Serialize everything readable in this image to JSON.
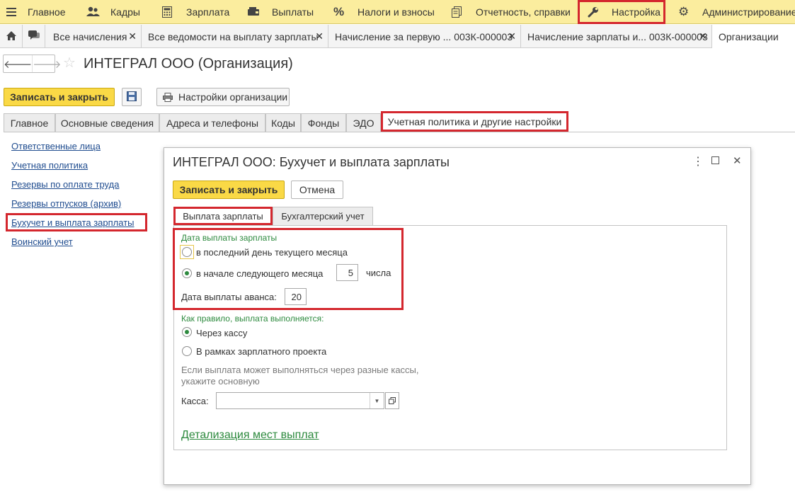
{
  "top_menu": {
    "items": [
      {
        "label": "Главное",
        "icon": "hamburger-icon"
      },
      {
        "label": "Кадры",
        "icon": "people-icon"
      },
      {
        "label": "Зарплата",
        "icon": "calculator-icon"
      },
      {
        "label": "Выплаты",
        "icon": "wallet-icon"
      },
      {
        "label": "Налоги и взносы",
        "icon": "percent-icon"
      },
      {
        "label": "Отчетность, справки",
        "icon": "documents-icon"
      },
      {
        "label": "Настройка",
        "icon": "wrench-icon"
      },
      {
        "label": "Администрирование",
        "icon": "gear-icon"
      }
    ]
  },
  "window_tabs": [
    "Все начисления",
    "Все ведомости на выплату зарплаты",
    "Начисление за первую ... 003К-000003",
    "Начисление зарплаты и... 003К-000003",
    "Организации"
  ],
  "page": {
    "title": "ИНТЕГРАЛ ООО (Организация)"
  },
  "commands": {
    "save_close": "Записать и закрыть",
    "org_settings": "Настройки организации"
  },
  "form_tabs": [
    "Главное",
    "Основные сведения",
    "Адреса и телефоны",
    "Коды",
    "Фонды",
    "ЭДО",
    "Учетная политика и другие настройки"
  ],
  "left_links": [
    "Ответственные лица",
    "Учетная политика",
    "Резервы по оплате труда",
    "Резервы отпусков (архив)",
    "Бухучет и выплата зарплаты",
    "Воинский учет"
  ],
  "dialog": {
    "title": "ИНТЕГРАЛ ООО: Бухучет и выплата зарплаты",
    "save_close": "Записать и закрыть",
    "cancel": "Отмена",
    "tabs": [
      "Выплата зарплаты",
      "Бухгалтерский учет"
    ],
    "pay_date_group": "Дата выплаты зарплаты",
    "option_last_day": "в последний день текущего месяца",
    "option_next_month": "в начале следующего месяца",
    "next_month_day": "5",
    "day_suffix": "числа",
    "advance_label": "Дата выплаты аванса:",
    "advance_day": "20",
    "payment_method_group": "Как правило, выплата выполняется:",
    "option_cash": "Через кассу",
    "option_project": "В рамках зарплатного проекта",
    "hint_line1": "Если выплата может выполняться через разные кассы,",
    "hint_line2": "укажите основную",
    "cash_label": "Касса:",
    "cash_value": "",
    "details_link": "Детализация мест выплат"
  },
  "colors": {
    "menu_bg": "#fbed9e",
    "highlight": "#d4272e",
    "accent_green": "#2d8a3e",
    "button_yellow": "#fad946"
  }
}
